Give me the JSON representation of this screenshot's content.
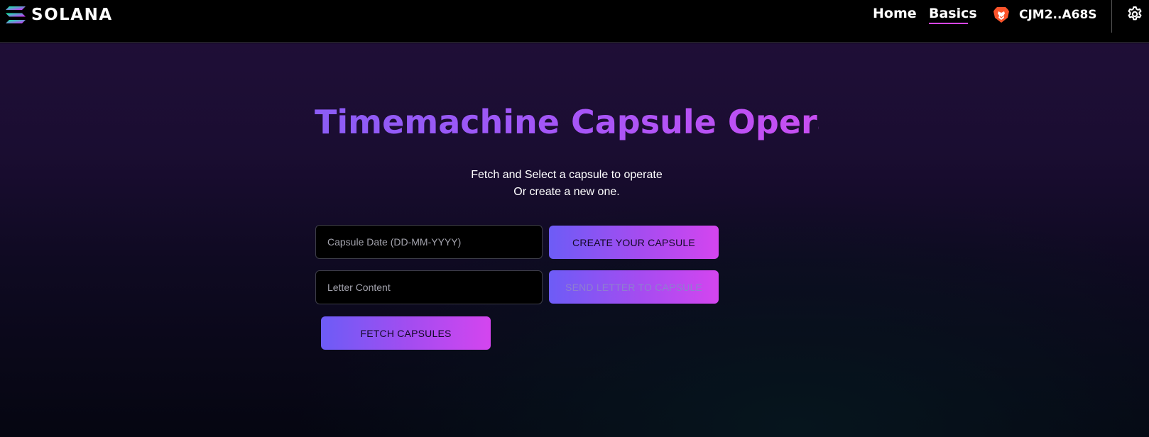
{
  "header": {
    "logo_text": "SOLANA",
    "nav": [
      {
        "label": "Home",
        "active": false
      },
      {
        "label": "Basics",
        "active": true
      }
    ],
    "wallet": {
      "label": "CJM2..A68S",
      "icon": "brave-lion-icon"
    },
    "settings_icon": "gear-icon"
  },
  "main": {
    "title": "Timemachine Capsule Operator",
    "subtitle_line1": "Fetch and Select a capsule to operate",
    "subtitle_line2": "Or create a new one.",
    "capsule_date_input": {
      "placeholder": "Capsule Date (DD-MM-YYYY)",
      "value": ""
    },
    "letter_content_input": {
      "placeholder": "Letter Content",
      "value": ""
    },
    "buttons": {
      "create": "CREATE YOUR CAPSULE",
      "send": "SEND LETTER TO CAPSULE",
      "fetch": "FETCH CAPSULES"
    }
  },
  "colors": {
    "accent_start": "#6d5cf6",
    "accent_end": "#d445ef",
    "title_gradient_start": "#8b5cf6",
    "title_gradient_end": "#c84ef2",
    "nav_underline": "#d946ef",
    "background_top": "#1f0e37"
  }
}
